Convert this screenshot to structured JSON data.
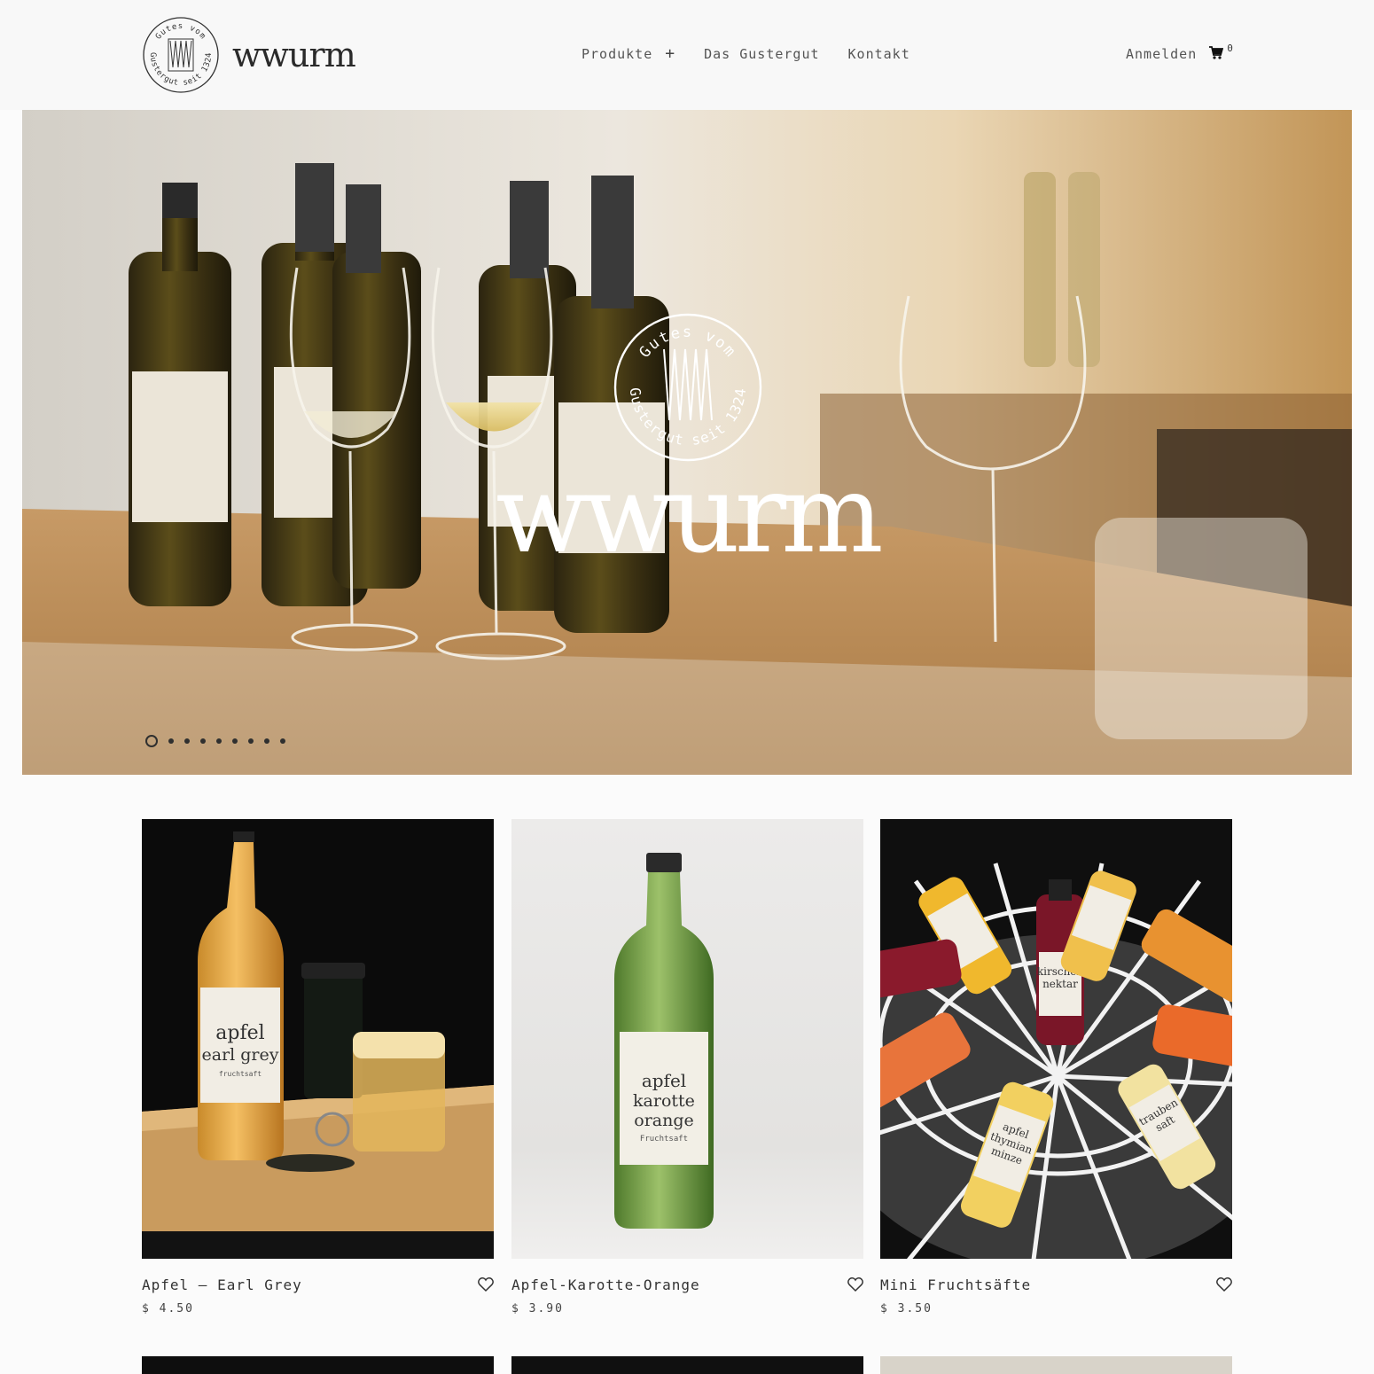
{
  "brand": {
    "wordmark": "wwurm",
    "badge_top": "Gutes vom",
    "badge_bottom": "Gustergut seit 1324"
  },
  "nav": {
    "items": [
      {
        "label": "Produkte",
        "has_submenu": true,
        "submenu_symbol": "+"
      },
      {
        "label": "Das Gustergut"
      },
      {
        "label": "Kontakt"
      }
    ]
  },
  "account": {
    "login_label": "Anmelden",
    "cart_count": "0"
  },
  "hero": {
    "wordmark": "wwurm",
    "badge_top": "Gutes vom",
    "badge_bottom": "Gustergut seit 1324",
    "slides_total": 9,
    "active_slide": 1
  },
  "products": [
    {
      "name": "Apfel – Earl Grey",
      "price": "$ 4.50",
      "label_lines": [
        "apfel",
        "earl grey",
        "fruchtsaft"
      ]
    },
    {
      "name": "Apfel-Karotte-Orange",
      "price": "$ 3.90",
      "label_lines": [
        "apfel",
        "karotte",
        "orange",
        "Fruchtsaft"
      ]
    },
    {
      "name": "Mini Fruchtsäfte",
      "price": "$ 3.50",
      "label_lines": [
        "kirschen",
        "nektar",
        "apfel",
        "thymian",
        "minze",
        "trauben",
        "saft"
      ]
    }
  ],
  "colors": {
    "header_bg": "#f8f8f8",
    "page_bg": "#fbfbfb",
    "text": "#333333"
  },
  "icons": {
    "cart": "cart-icon",
    "wishlist": "heart-icon",
    "submenu": "plus-icon"
  }
}
